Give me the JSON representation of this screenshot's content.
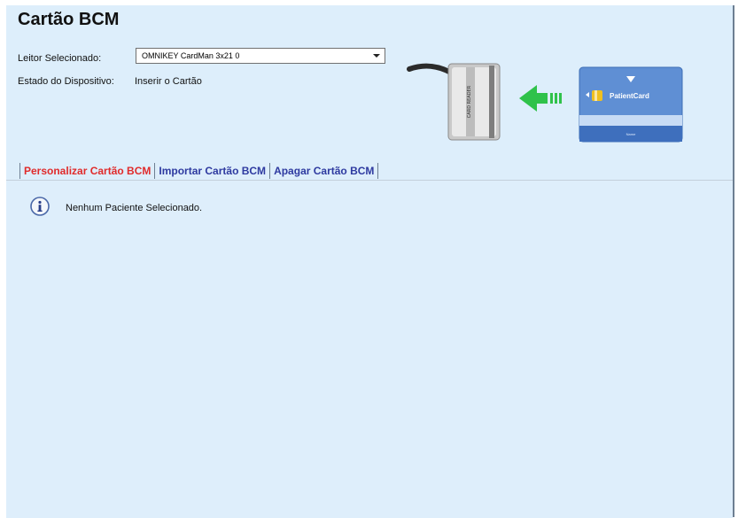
{
  "title": "Cartão BCM",
  "reader": {
    "label": "Leitor Selecionado:",
    "selected": "OMNIKEY CardMan 3x21 0"
  },
  "device": {
    "label": "Estado do Dispositivo:",
    "value": "Inserir o Cartão"
  },
  "illustration": {
    "reader_text": "CARD READER",
    "card_brand": "PatientCard",
    "card_footer": "Name",
    "arrow_color": "#2fc24a",
    "card_color": "#5f8fd4"
  },
  "tabs": [
    {
      "label": "Personalizar Cartão BCM",
      "active": true
    },
    {
      "label": "Importar Cartão BCM",
      "active": false
    },
    {
      "label": "Apagar Cartão BCM",
      "active": false
    }
  ],
  "message": {
    "icon": "info-icon",
    "text": "Nenhum Paciente Selecionado."
  },
  "colors": {
    "panel_bg": "#ddeefb",
    "active_tab": "#e02b2b",
    "inactive_tab": "#2e3aa0"
  }
}
